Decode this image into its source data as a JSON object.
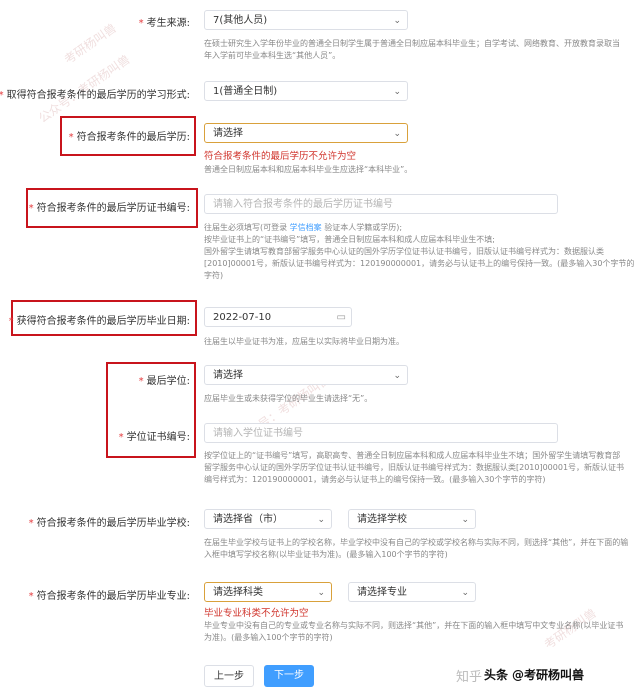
{
  "fields": {
    "source": {
      "label": "考生来源:",
      "value": "7(其他人员)",
      "hint": [
        "在硕士研究生入学年份毕业的普通全日制学生属于普通全日制应届本科毕业生；自学考试、网络教育、开放教育录取当",
        "年入学前可毕业本科生选“其他人员”。"
      ]
    },
    "study_form": {
      "label": "取得符合报考条件的最后学历的学习形式:",
      "value": "1(普通全日制)"
    },
    "last_degree": {
      "label": "符合报考条件的最后学历:",
      "value": "请选择",
      "error": "符合报考条件的最后学历不允许为空",
      "hint": "普通全日制应届本科和应届本科毕业生应选择“本科毕业”。"
    },
    "cert_no": {
      "label": "符合报考条件的最后学历证书编号:",
      "placeholder": "请输入符合报考条件的最后学历证书编号",
      "hint_pre": "往届生必须填写(可登录 ",
      "hint_link": "学信档案",
      "hint_post": " 验证本人学籍或学历);",
      "hint_lines": [
        "按毕业证书上的“证书编号”填写，普通全日制应届本科和成人应届本科毕业生不填;",
        "国外留学生请填写教育部留学服务中心认证的国外学历学位证书认证书编号，旧版认证书编号样式为：数据服认类",
        "[2010]00001号，新版认证书编号样式为：120190000001，请务必与认证书上的编号保持一致。(最多输入30个字节的",
        "字符)"
      ]
    },
    "grad_date": {
      "label": "获得符合报考条件的最后学历毕业日期:",
      "value": "2022-07-10",
      "hint": "往届生以毕业证书为准，应届生以实际将毕业日期为准。"
    },
    "last_degree_title": {
      "label": "最后学位:",
      "value": "请选择",
      "hint": "应届毕业生或未获得学位的毕业生请选择“无”。"
    },
    "degree_cert": {
      "label": "学位证书编号:",
      "placeholder": "请输入学位证书编号",
      "hint_lines": [
        "按学位证上的“证书编号”填写，高职高专、普通全日制应届本科和成人应届本科毕业生不填；国外留学生请填写教育部",
        "留学服务中心认证的国外学历学位证书认证书编号，旧版认证书编号样式为：数据服认类[2010]00001号，新版认证书",
        "编号样式为：120190000001，请务必与认证书上的编号保持一致。(最多输入30个字节的字符)"
      ]
    },
    "school": {
      "label": "符合报考条件的最后学历毕业学校:",
      "province": "请选择省（市）",
      "school": "请选择学校",
      "hint_lines": [
        "在届生毕业学校与证书上的学校名称，毕业学校中没有自己的学校或学校名称与实际不同，则选择“其他”，并在下面的输",
        "入框中填写学校名称(以毕业证书为准)。(最多输入100个字节的字符)"
      ]
    },
    "major": {
      "label": "符合报考条件的最后学历毕业专业:",
      "category": "请选择科类",
      "major": "请选择专业",
      "error": "毕业专业科类不允许为空",
      "hint_lines": [
        "毕业专业中没有自己的专业或专业名称与实际不同，则选择“其他”，并在下面的输入框中填写中文专业名称(以毕业证书",
        "为准)。(最多输入100个字节的字符)"
      ]
    }
  },
  "buttons": {
    "prev": "上一步",
    "next": "下一步"
  },
  "watermarks": [
    "考研杨叫兽",
    "公众号：考研杨叫兽",
    "公众号：考研杨叫兽",
    "考研杨叫兽"
  ],
  "branding": {
    "zhihu": "知乎",
    "at": "@考研杨叫兽",
    "toutiao": "头条"
  },
  "colors": {
    "required": "#e4393c",
    "error": "#d0342c",
    "primary": "#409eff",
    "annotation": "#c8141c",
    "link": "#409eff"
  }
}
